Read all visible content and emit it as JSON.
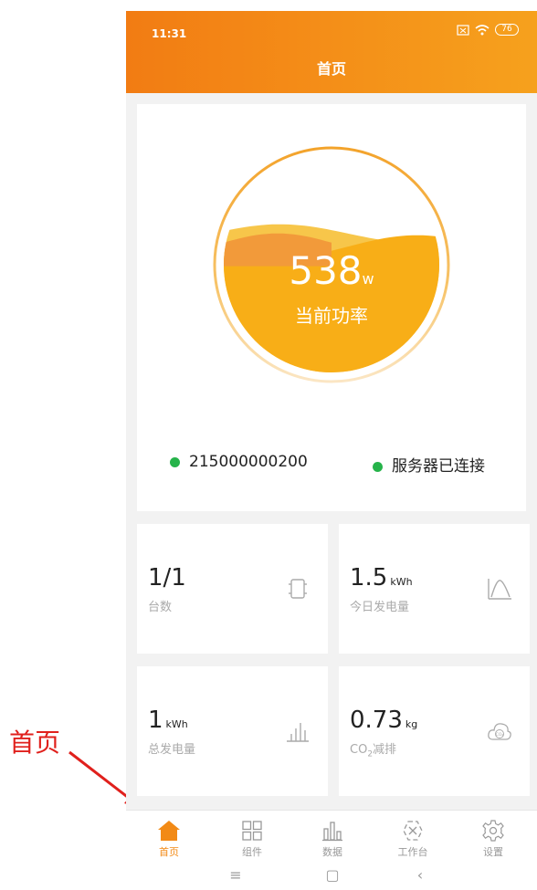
{
  "annotation": {
    "text": "首页"
  },
  "status_bar": {
    "time": "11:31",
    "battery": "76"
  },
  "header": {
    "title": "首页"
  },
  "power": {
    "value": "538",
    "unit": "w",
    "label": "当前功率",
    "fill_level": 0.62
  },
  "device": {
    "serial": "215000000200",
    "server_status": "服务器已连接"
  },
  "stats": {
    "count": {
      "value": "1/1",
      "unit": "",
      "label": "台数"
    },
    "today": {
      "value": "1.5",
      "unit": "kWh",
      "label": "今日发电量"
    },
    "total": {
      "value": "1",
      "unit": "kWh",
      "label": "总发电量"
    },
    "co2": {
      "value": "0.73",
      "unit": "kg",
      "label_prefix": "CO",
      "label_sub": "2",
      "label_suffix": "减排"
    }
  },
  "tabs": [
    {
      "label": "首页",
      "icon": "home-icon"
    },
    {
      "label": "组件",
      "icon": "grid-icon"
    },
    {
      "label": "数据",
      "icon": "bar-chart-icon"
    },
    {
      "label": "工作台",
      "icon": "workbench-icon"
    },
    {
      "label": "设置",
      "icon": "gear-icon"
    }
  ],
  "nav": {
    "menu": "≡",
    "home": "▢",
    "back": "‹"
  },
  "colors": {
    "accent": "#f28a16",
    "online": "#26b34a",
    "annotation": "#e0201c"
  }
}
